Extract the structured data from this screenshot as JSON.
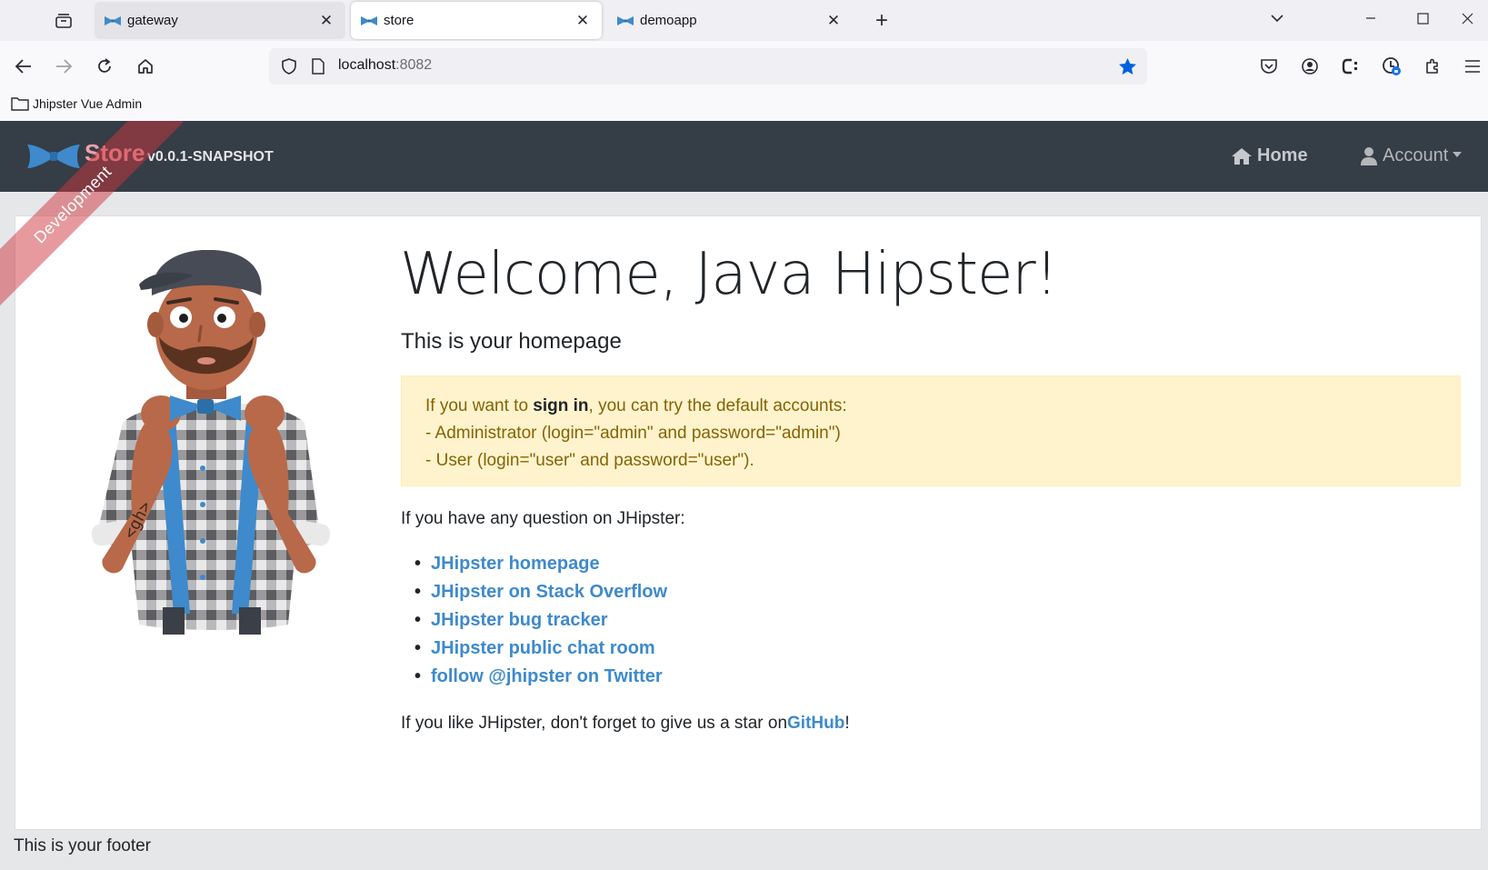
{
  "browser": {
    "tabs": [
      {
        "title": "gateway",
        "active": false
      },
      {
        "title": "store",
        "active": true
      },
      {
        "title": "demoapp",
        "active": false
      }
    ],
    "url_host": "localhost",
    "url_port": ":8082",
    "bookmarks": [
      {
        "label": "Jhipster Vue Admin"
      }
    ]
  },
  "app": {
    "brand_title": "Store",
    "brand_version": "v0.0.1-SNAPSHOT",
    "ribbon": "Development",
    "nav": {
      "home": "Home",
      "account": "Account"
    }
  },
  "main": {
    "title": "Welcome, Java Hipster!",
    "subtitle": "This is your homepage",
    "alert": {
      "pre": "If you want to ",
      "bold": "sign in",
      "post": ", you can try the default accounts:",
      "line2": "- Administrator (login=\"admin\" and password=\"admin\")",
      "line3": "- User (login=\"user\" and password=\"user\")."
    },
    "question": "If you have any question on JHipster:",
    "links": [
      "JHipster homepage",
      "JHipster on Stack Overflow",
      "JHipster bug tracker",
      "JHipster public chat room",
      "follow @jhipster on Twitter"
    ],
    "star_pre": "If you like JHipster, don't forget to give us a star on",
    "star_link": "GitHub",
    "star_post": "!"
  },
  "footer": "This is your footer",
  "colors": {
    "navbar": "#353d47",
    "link": "#3e8acc",
    "alert_bg": "#fff3cd",
    "alert_text": "#856404",
    "ribbon": "#cd363d",
    "bookmark_star": "#0061e0"
  }
}
